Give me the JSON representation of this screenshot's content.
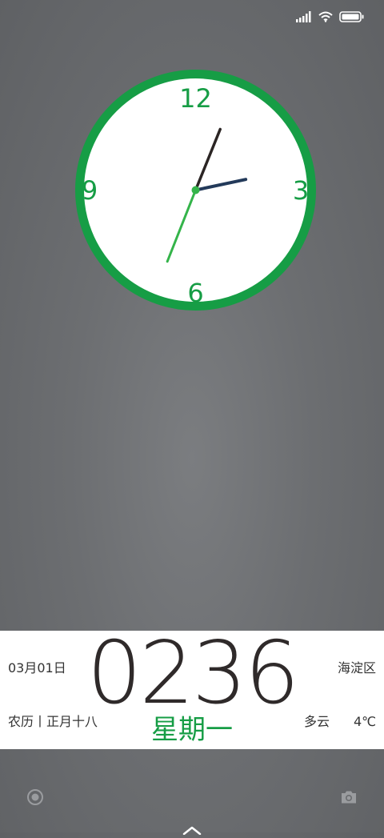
{
  "status_bar": {
    "icons": [
      "signal-icon",
      "wifi-icon",
      "battery-icon"
    ]
  },
  "analog_clock": {
    "numerals": {
      "n12": "12",
      "n3": "3",
      "n6": "6",
      "n9": "9"
    },
    "hour": 2,
    "minute": 36,
    "colors": {
      "ring": "#169d45",
      "face": "#ffffff",
      "hour_hand": "#233a5a",
      "minute_hand": "#34b44a",
      "counter_hand": "#2b2524",
      "numerals": "#169d45"
    }
  },
  "info_panel": {
    "time": "0236",
    "weekday": "星期一",
    "date": "03月01日",
    "lunar": "农历丨正月十八",
    "location": "海淀区",
    "weather": "多云",
    "temperature": "4℃",
    "colors": {
      "accent": "#169d45",
      "digits": "#2f2a2a"
    }
  },
  "bottom_bar": {
    "icons": [
      "record-icon",
      "camera-icon",
      "chevron-up-icon"
    ]
  }
}
